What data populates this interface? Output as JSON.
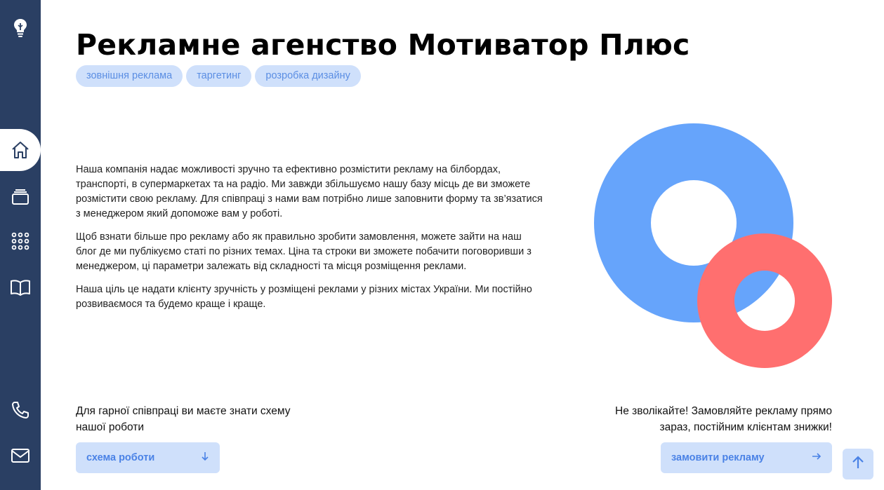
{
  "page": {
    "title": "Рекламне агенство Мотиватор Плюс",
    "tags": [
      "зовнішня реклама",
      "таргетинг",
      "розробка дизайну"
    ],
    "paragraphs": [
      "Наша компанія надає можливості зручно та ефективно розмістити рекламу на білбордах, транспорті, в супермаркетах та на радіо. Ми завжди збільшуємо нашу базу місць де ви зможете розмістити свою рекламу. Для співпраці з нами вам потрібно лише заповнити форму та зв’язатися з менеджером який допоможе вам у роботі.",
      "Щоб взнати більше про рекламу або як правильно зробити замовлення, можете зайти на наш блог де ми публікуємо статі по різних темах. Ціна та строки ви зможете побачити поговоривши з менеджером, ці параметри залежать від складності та місця розміщення реклами.",
      "Наша ціль це надати клієнту зручність у розміщені реклами у різних містах України. Ми постійно розвиваємося та будемо краще і краще."
    ]
  },
  "bottom": {
    "left_text": "Для гарної співпраці ви маєте знати схему нашої роботи",
    "scheme_button": "схема роботи",
    "right_text": "Не зволікайте! Замовляйте рекламу прямо зараз, постійним клієнтам знижки!",
    "order_button": "замовити рекламу"
  },
  "icons": {
    "sidebar": [
      "lightbulb-icon",
      "home-icon",
      "cards-icon",
      "apps-grid-icon",
      "book-icon",
      "phone-icon",
      "mail-icon"
    ],
    "scheme_button": "arrow-down-icon",
    "order_button": "arrow-right-icon",
    "scroll": "arrow-up-icon"
  },
  "colors": {
    "sidebar": "#2a3f63",
    "tag_bg": "#cfe0fb",
    "accent": "#4a82e6",
    "ring_blue": "#66a4fb",
    "ring_red": "#ff6f6f"
  }
}
